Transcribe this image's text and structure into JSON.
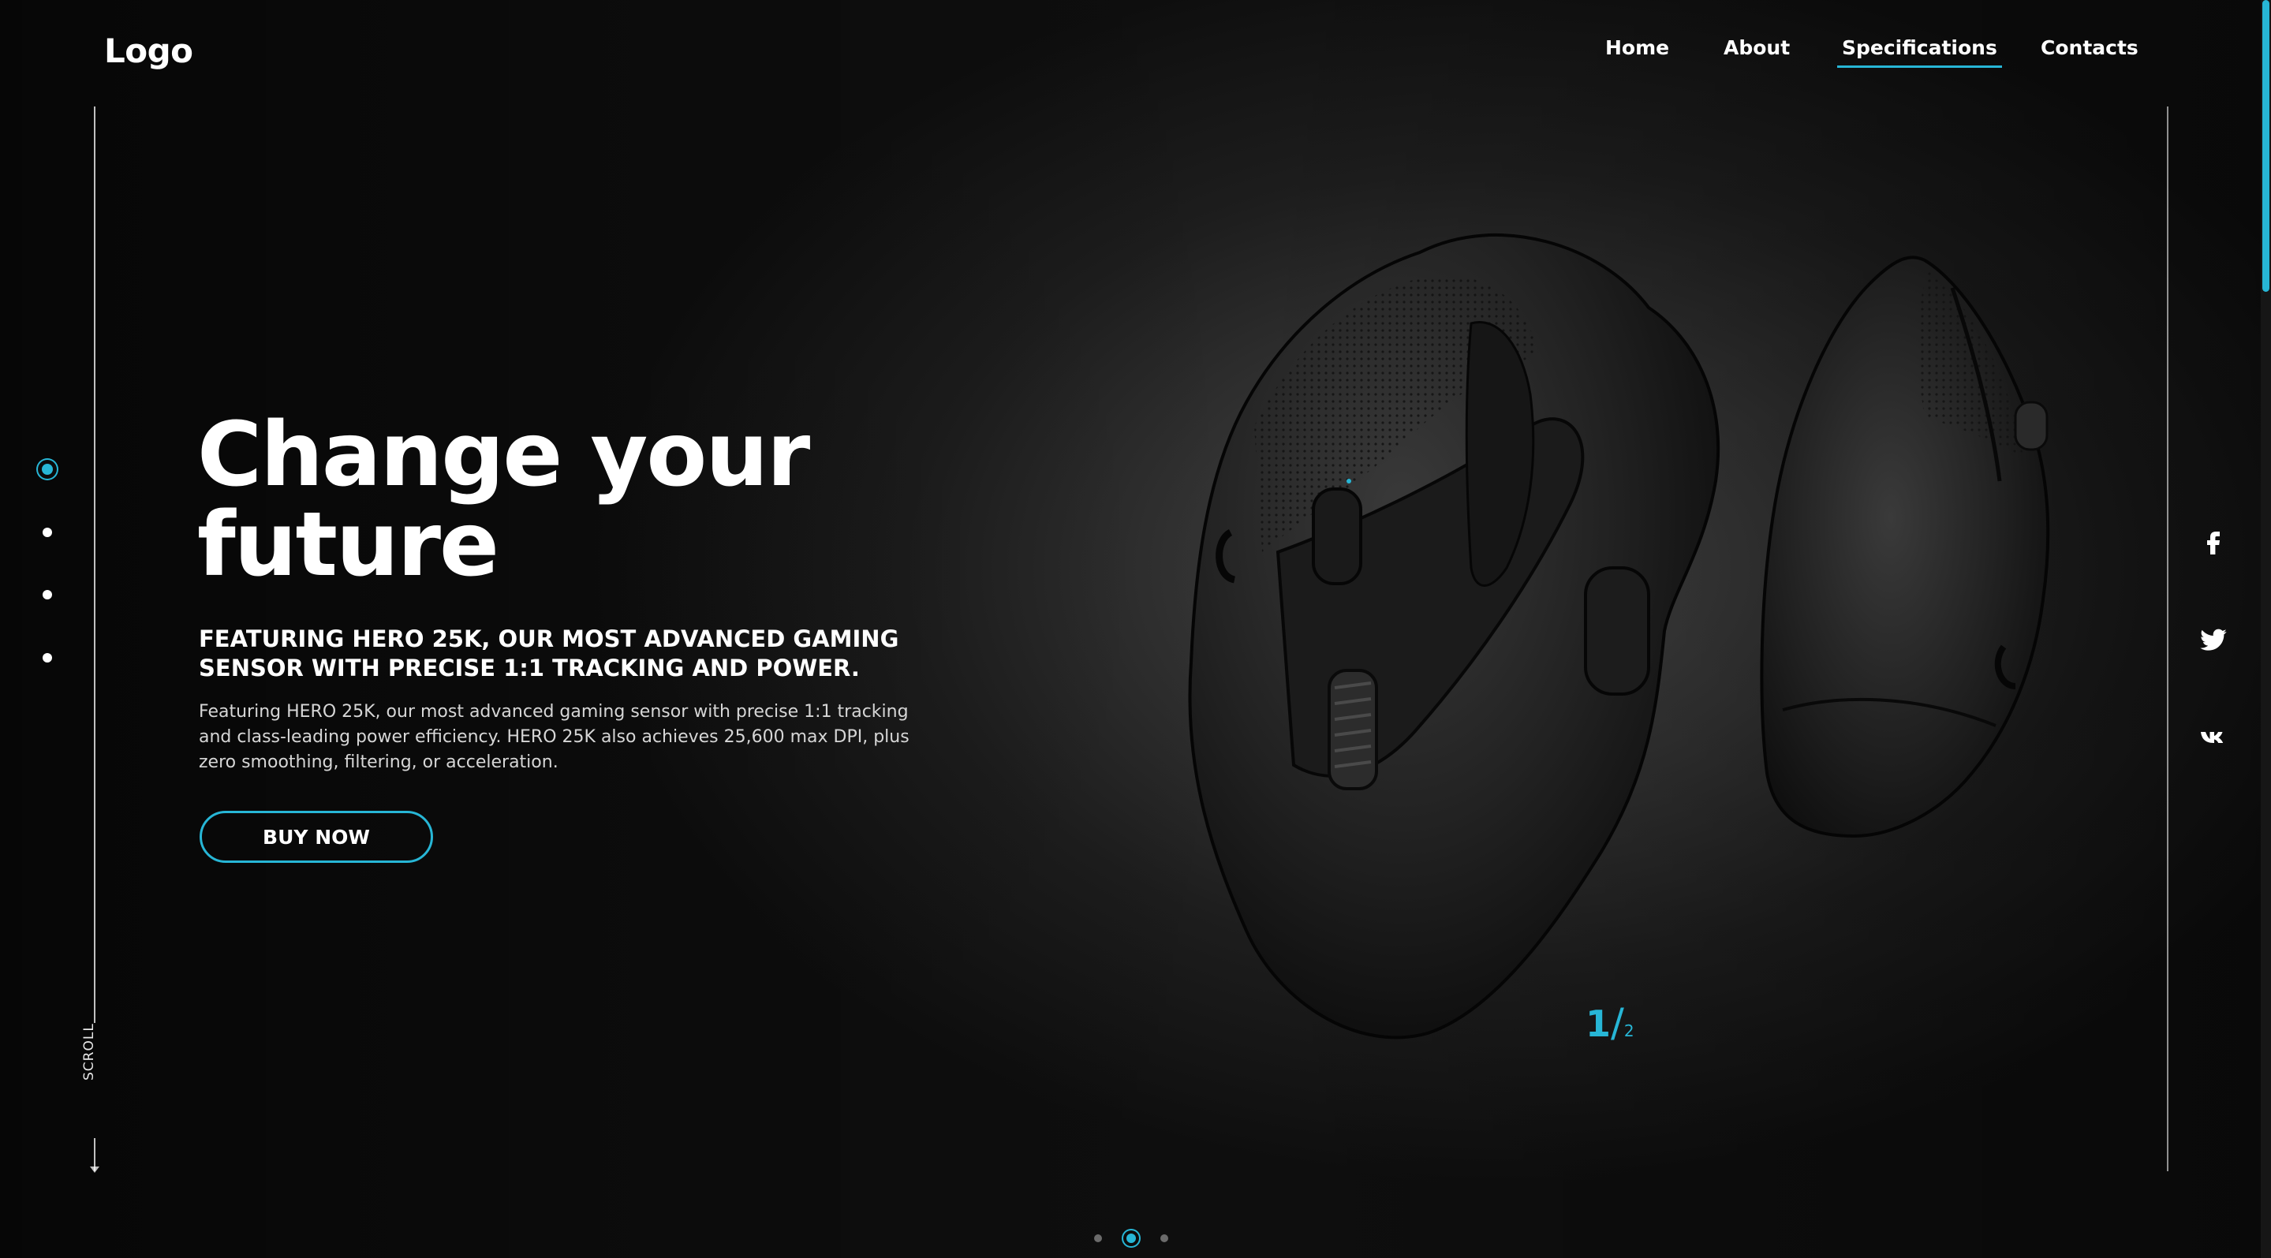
{
  "header": {
    "logo": "Logo",
    "nav": [
      {
        "label": "Home"
      },
      {
        "label": "About"
      },
      {
        "label": "Specifications",
        "active": true
      },
      {
        "label": "Contacts"
      }
    ]
  },
  "hero": {
    "title_line1": "Change your",
    "title_line2": "future",
    "subtitle": "FEATURING HERO 25K, OUR MOST ADVANCED GAMING SENSOR WITH PRECISE 1:1 TRACKING AND POWER.",
    "description": "Featuring HERO 25K, our most advanced gaming sensor with precise 1:1 tracking and class-leading power efficiency. HERO 25K also achieves 25,600 max DPI, plus zero smoothing, filtering, or acceleration.",
    "cta_label": "BUY NOW"
  },
  "slider": {
    "current": "1",
    "separator": "/",
    "total": "2"
  },
  "scroll": {
    "label": "SCROLL"
  },
  "side_pager": {
    "count": 4,
    "active_index": 0
  },
  "bottom_pager": {
    "count": 3,
    "active_index": 1
  },
  "socials": [
    "facebook-icon",
    "twitter-icon",
    "vk-icon"
  ],
  "colors": {
    "accent": "#27b6d6",
    "background": "#0b0b0b",
    "text": "#ffffff"
  }
}
